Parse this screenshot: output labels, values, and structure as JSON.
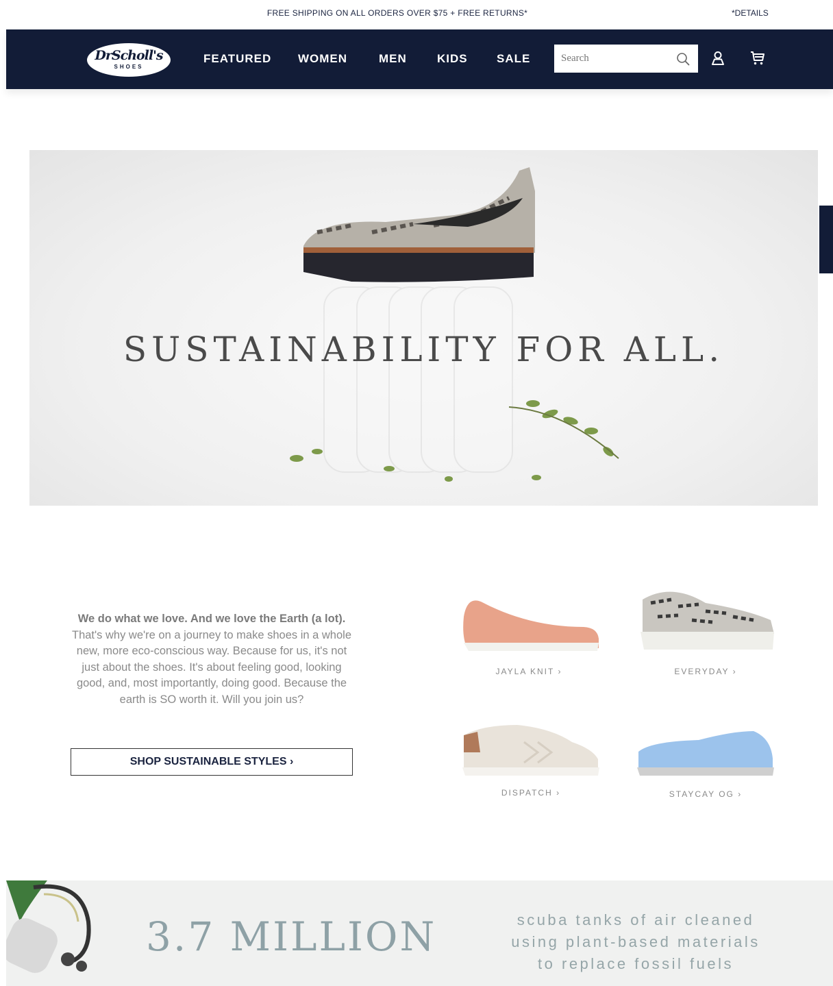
{
  "promo": {
    "text": "FREE SHIPPING ON ALL ORDERS OVER $75 + FREE RETURNS*",
    "details": "*DETAILS"
  },
  "header": {
    "logo_main": "DrScholl's",
    "logo_sub": "SHOES",
    "nav": [
      "FEATURED",
      "WOMEN",
      "MEN",
      "KIDS",
      "SALE"
    ],
    "search_placeholder": "Search"
  },
  "hero": {
    "title": "SUSTAINABILITY FOR ALL."
  },
  "intro": {
    "bold": "We do what we love. And we love the Earth (a lot).",
    "text": " That's why we're on a journey to make shoes in a whole new, more eco-conscious way. Because for us, it's not just about the shoes. It's about feeling good, looking good, and, most importantly, doing good. Because the earth is SO worth it. Will you join us?",
    "button": "SHOP SUSTAINABLE STYLES ›"
  },
  "products": [
    {
      "label": "JAYLA KNIT ›",
      "icon": "pink-knit-flat"
    },
    {
      "label": "EVERYDAY ›",
      "icon": "snakeskin-sneaker"
    },
    {
      "label": "DISPATCH ›",
      "icon": "cream-sneaker"
    },
    {
      "label": "STAYCAY OG ›",
      "icon": "blue-fuzzy-slide"
    }
  ],
  "stats": {
    "number": "3.7 MILLION",
    "desc_line1": "scuba tanks of air cleaned",
    "desc_line2": "using plant-based materials",
    "desc_line3": "to replace fossil fuels"
  },
  "colors": {
    "navy": "#121c37",
    "stat_text": "#8ea1a6"
  }
}
